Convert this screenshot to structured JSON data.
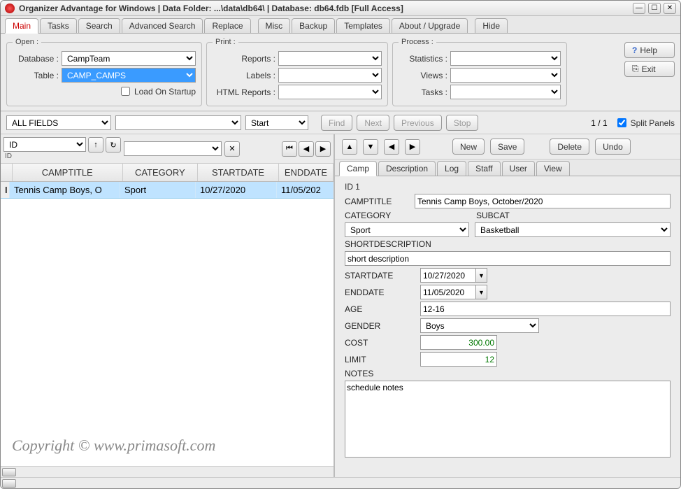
{
  "title": "Organizer Advantage for Windows | Data Folder: ...\\data\\db64\\ | Database: db64.fdb [Full Access]",
  "mainTabs": [
    "Main",
    "Tasks",
    "Search",
    "Advanced Search",
    "Replace",
    "Misc",
    "Backup",
    "Templates",
    "About / Upgrade",
    "Hide"
  ],
  "open": {
    "legend": "Open :",
    "databaseLbl": "Database :",
    "database": "CampTeam",
    "tableLbl": "Table :",
    "table": "CAMP_CAMPS",
    "loadOnStartup": "Load On Startup"
  },
  "print": {
    "legend": "Print :",
    "reportsLbl": "Reports :",
    "labelsLbl": "Labels :",
    "htmlLbl": "HTML Reports :"
  },
  "process": {
    "legend": "Process :",
    "statsLbl": "Statistics :",
    "viewsLbl": "Views :",
    "tasksLbl": "Tasks :"
  },
  "sideBtns": {
    "help": "Help",
    "exit": "Exit"
  },
  "filterbar": {
    "allFields": "ALL FIELDS",
    "start": "Start",
    "find": "Find",
    "next": "Next",
    "prev": "Previous",
    "stop": "Stop",
    "page": "1 / 1",
    "split": "Split Panels"
  },
  "left": {
    "sortField": "ID",
    "sortField2": "ID",
    "cols": [
      "CAMPTITLE",
      "CATEGORY",
      "STARTDATE",
      "ENDDATE"
    ],
    "row": [
      "Tennis Camp Boys, O",
      "Sport",
      "10/27/2020",
      "11/05/202"
    ],
    "rowMarker": "I"
  },
  "rightTool": {
    "new": "New",
    "save": "Save",
    "delete": "Delete",
    "undo": "Undo"
  },
  "detailTabs": [
    "Camp",
    "Description",
    "Log",
    "Staff",
    "User",
    "View"
  ],
  "form": {
    "idLbl": "ID",
    "id": "1",
    "campTitleLbl": "CAMPTITLE",
    "campTitle": "Tennis Camp Boys, October/2020",
    "categoryLbl": "CATEGORY",
    "category": "Sport",
    "subcatLbl": "SUBCAT",
    "subcat": "Basketball",
    "shortDescLbl": "SHORTDESCRIPTION",
    "shortDesc": "short description",
    "startLbl": "STARTDATE",
    "start": "10/27/2020",
    "endLbl": "ENDDATE",
    "end": "11/05/2020",
    "ageLbl": "AGE",
    "age": "12-16",
    "genderLbl": "GENDER",
    "gender": "Boys",
    "costLbl": "COST",
    "cost": "300.00",
    "limitLbl": "LIMIT",
    "limit": "12",
    "notesLbl": "NOTES",
    "notes": "schedule notes"
  },
  "watermark": "Copyright ©   www.primasoft.com"
}
